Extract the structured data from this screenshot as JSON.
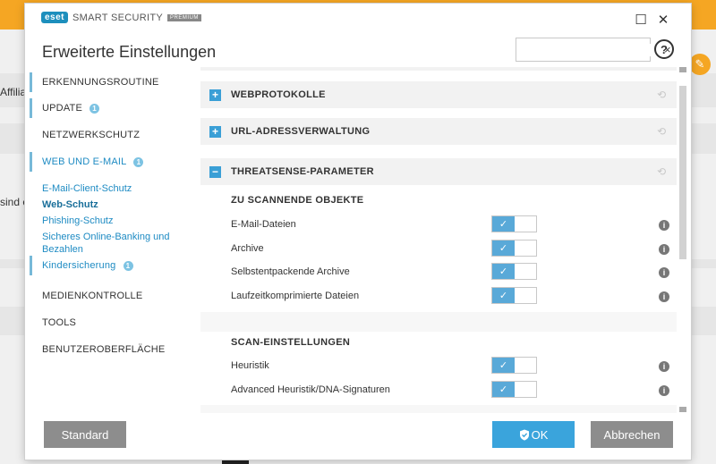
{
  "app": {
    "brand_logo": "eset",
    "brand_name": "SMART SECURITY",
    "brand_tier": "PREMIUM",
    "dialog_title": "Erweiterte Einstellungen"
  },
  "background": {
    "text_affiliate": "Affiliate",
    "text_sind": "sind e"
  },
  "window_controls": {
    "maximize": "☐",
    "close": "✕"
  },
  "search": {
    "value": "",
    "placeholder": "",
    "clear": "×"
  },
  "help": {
    "label": "?"
  },
  "sidebar": {
    "items": [
      {
        "label": "ERKENNUNGSROUTINE",
        "badge": ""
      },
      {
        "label": "UPDATE",
        "badge": "1"
      },
      {
        "label": "NETZWERKSCHUTZ",
        "badge": ""
      },
      {
        "label": "WEB UND E-MAIL",
        "badge": "1"
      },
      {
        "label": "MEDIENKONTROLLE",
        "badge": ""
      },
      {
        "label": "TOOLS",
        "badge": ""
      },
      {
        "label": "BENUTZEROBERFLÄCHE",
        "badge": ""
      }
    ],
    "sub_items": [
      {
        "label": "E-Mail-Client-Schutz"
      },
      {
        "label": "Web-Schutz"
      },
      {
        "label": "Phishing-Schutz"
      },
      {
        "label": "Sicheres Online-Banking und Bezahlen"
      },
      {
        "label": "Kindersicherung",
        "badge": "1"
      }
    ]
  },
  "main": {
    "sections": [
      {
        "label": "WEBPROTOKOLLE",
        "toggle": "+"
      },
      {
        "label": "URL-ADRESSVERWALTUNG",
        "toggle": "+"
      },
      {
        "label": "THREATSENSE-PARAMETER",
        "toggle": "−"
      }
    ],
    "groups": [
      {
        "title": "ZU SCANNENDE OBJEKTE",
        "rows": [
          {
            "label": "E-Mail-Dateien",
            "enabled": true
          },
          {
            "label": "Archive",
            "enabled": true
          },
          {
            "label": "Selbstentpackende Archive",
            "enabled": true
          },
          {
            "label": "Laufzeitkomprimierte Dateien",
            "enabled": true
          }
        ]
      },
      {
        "title": "SCAN-EINSTELLUNGEN",
        "rows": [
          {
            "label": "Heuristik",
            "enabled": true
          },
          {
            "label": "Advanced Heuristik/DNA-Signaturen",
            "enabled": true
          }
        ]
      }
    ]
  },
  "footer": {
    "standard": "Standard",
    "ok": "OK",
    "cancel": "Abbrechen"
  },
  "colors": {
    "accent": "#3aa4dc",
    "switch_on": "#59a9d8",
    "link": "#1e8bc3",
    "background_bar": "#f5a623"
  }
}
